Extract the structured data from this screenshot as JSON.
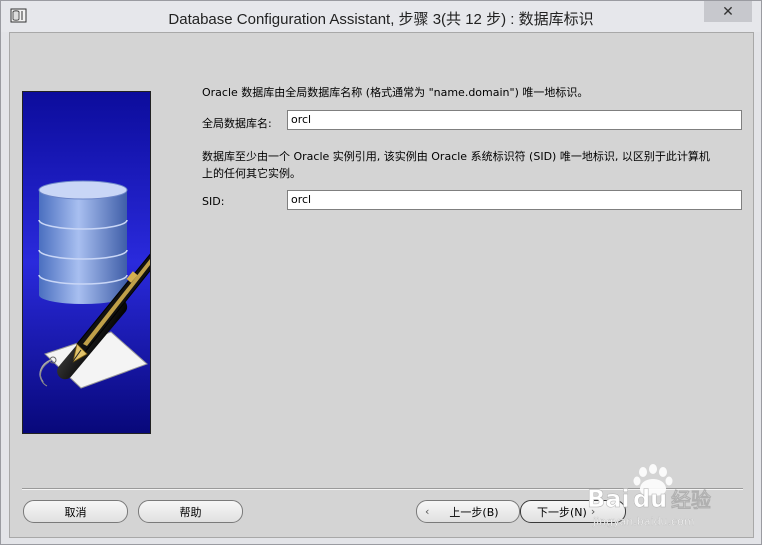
{
  "window": {
    "title": "Database Configuration Assistant, 步骤 3(共 12 步) : 数据库标识",
    "close_glyph": "✕"
  },
  "form": {
    "intro": "Oracle 数据库由全局数据库名称 (格式通常为 \"name.domain\") 唯一地标识。",
    "global_db_label": "全局数据库名:",
    "global_db_value": "orcl",
    "sid_desc_line1": "数据库至少由一个 Oracle 实例引用, 该实例由 Oracle 系统标识符 (SID) 唯一地标识, 以区别于此计算机",
    "sid_desc_line2": "上的任何其它实例。",
    "sid_label": "SID:",
    "sid_value": "orcl"
  },
  "buttons": {
    "cancel": "取消",
    "help": "帮助",
    "back": "上一步(B)",
    "next": "下一步(N)"
  },
  "watermark": {
    "brand": "Bai",
    "brand2": "du",
    "suffix": "经验",
    "url": "jingyan.baidu.com"
  },
  "colors": {
    "panel_bg": "#d4d4d4",
    "image_blue": "#1a1ab4"
  }
}
